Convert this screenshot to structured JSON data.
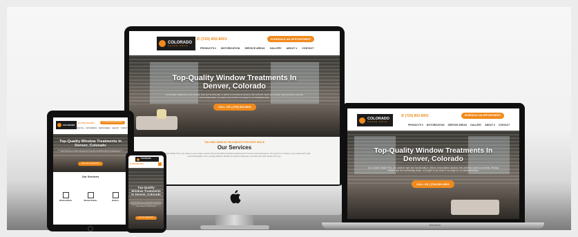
{
  "brand": {
    "name": "COLORADO",
    "sub": "SHADE PROS"
  },
  "phone": "(720) 802-8001",
  "cta": "SCHEDULE AN APPOINTMENT",
  "nav": [
    "PRODUCTS ▾",
    "MOTORIZATION",
    "SERVICE AREAS",
    "GALLERY",
    "ABOUT ▾",
    "CONTACT"
  ],
  "hero": {
    "title": "Top-Quality Window Treatments In Denver, Colorado",
    "body": "At Colorado Shade Pros, we combine style and functionality to deliver personalized solutions that perfectly match your needs. Serving Denver and the surrounding areas, no project is too small or too large for our dedicated team.",
    "button": "CALL US | (720) 802-8001"
  },
  "services": {
    "eyebrow": "TAILORED WINDOW TREATMENTS FOR EVERY SPACE",
    "title": "Our Services",
    "body": "At Colorado Shade Pros, we cater to your unique needs with personalized window treatments for homes and businesses. Our goal is to enhance your space with style and functionality. From energy-efficient shades to custom draperies, we have the right solution for you.",
    "tablet_title": "Our Services",
    "items": [
      "Window Blinds",
      "Window Shades",
      "Shutters"
    ]
  },
  "laptop_label": "MacBook"
}
